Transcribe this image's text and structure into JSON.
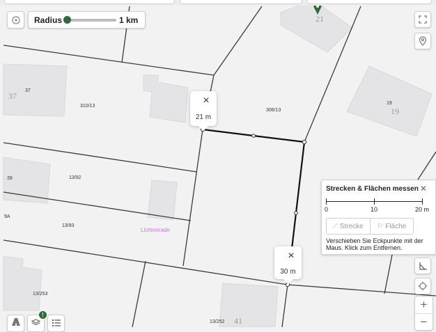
{
  "controls": {
    "radius_label": "Radius",
    "radius_value": "1 km",
    "radius_level_fraction": 0.05
  },
  "map": {
    "district_label": "Lichtenrade",
    "parcel_labels": [
      "37",
      "310/13",
      "306/13",
      "19",
      "13/92",
      "39",
      "9A",
      "13/93",
      "13/253",
      "13/252"
    ],
    "house_numbers": [
      "37",
      "21",
      "19",
      "41"
    ],
    "marker_color": "#2f6b3a"
  },
  "popups": {
    "first_segment": "21 m",
    "second_segment": "30 m"
  },
  "measure_panel": {
    "title": "Strecken & Flächen messen",
    "scale_labels": [
      "0",
      "10",
      "20 m"
    ],
    "distance_button": "Strecke",
    "area_button": "Fläche",
    "hint": "Verschieben Sie Eckpunkte mit der Maus. Klick zum Entfernen."
  },
  "layers_badge": "!",
  "icons": [
    "radius-target-icon",
    "fullscreen-icon",
    "location-pin-icon",
    "measure-ruler-icon",
    "locate-crosshair-icon",
    "zoom-in-icon",
    "zoom-out-icon",
    "basemap-icon",
    "layers-icon",
    "list-icon",
    "close-icon",
    "distance-icon",
    "area-flag-icon"
  ]
}
